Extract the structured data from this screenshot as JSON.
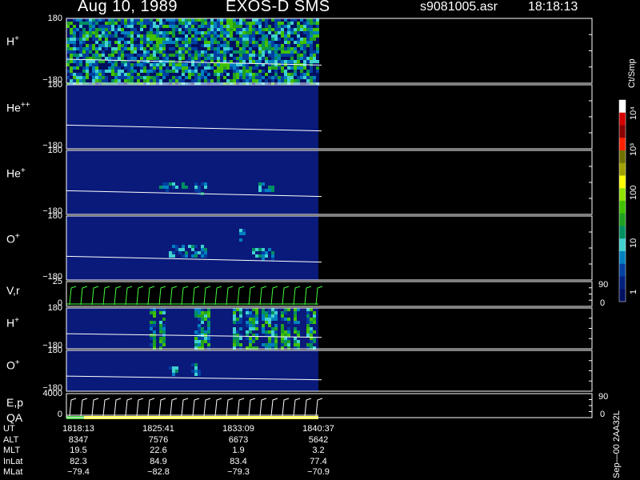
{
  "header": {
    "date": "Aug 10, 1989",
    "instrument": "EXOS-D SMS",
    "filename": "s9081005.asr",
    "time": "18:18:13"
  },
  "panels": [
    {
      "label": "H",
      "sup": "+",
      "ytop": "180",
      "ybot": "−180",
      "type": "spectrogram"
    },
    {
      "label": "He",
      "sup": "++",
      "ytop": "180",
      "ybot": "−180",
      "type": "spectrogram"
    },
    {
      "label": "He",
      "sup": "+",
      "ytop": "180",
      "ybot": "−180",
      "type": "spectrogram"
    },
    {
      "label": "O",
      "sup": "+",
      "ytop": "180",
      "ybot": "−180",
      "type": "spectrogram"
    },
    {
      "label": "V,r",
      "sup": "",
      "ytop": "25",
      "ybot": "0",
      "rtop": "90",
      "rbot": "0",
      "type": "line"
    },
    {
      "label": "H",
      "sup": "+",
      "ytop": "180",
      "ybot": "−180",
      "type": "spectrogram"
    },
    {
      "label": "O",
      "sup": "+",
      "ytop": "180",
      "ybot": "−180",
      "type": "spectrogram"
    },
    {
      "label": "E,p",
      "label2": "QA",
      "sup": "",
      "ytop": "4000",
      "ybot": "0",
      "rtop": "90",
      "rbot": "0",
      "type": "line"
    }
  ],
  "colorbar": {
    "units": "Ct/Smp",
    "labels": [
      "10⁴",
      "10³",
      "100",
      "10",
      "1"
    ],
    "colors": [
      "#ffffff",
      "#d40000",
      "#8a0000",
      "#ff2000",
      "#707000",
      "#a0a000",
      "#ffff00",
      "#90e000",
      "#40c000",
      "#20a020",
      "#009060",
      "#40d0d0",
      "#0080c0",
      "#0040a0",
      "#002080",
      "#001060"
    ]
  },
  "chart_data": {
    "type": "heatmap",
    "title": "Aug 10, 1989   EXOS-D SMS",
    "x_tick_labels": [
      "1818:13",
      "1825:41",
      "1833:09",
      "1840:37"
    ],
    "series": [
      {
        "name": "H+",
        "pitch_range": [
          -180,
          180
        ]
      },
      {
        "name": "He++",
        "pitch_range": [
          -180,
          180
        ]
      },
      {
        "name": "He+",
        "pitch_range": [
          -180,
          180
        ]
      },
      {
        "name": "O+",
        "pitch_range": [
          -180,
          180
        ]
      },
      {
        "name": "V,r",
        "range": [
          0,
          25
        ]
      },
      {
        "name": "H+",
        "pitch_range": [
          -180,
          180
        ]
      },
      {
        "name": "O+",
        "pitch_range": [
          -180,
          180
        ]
      },
      {
        "name": "E,p",
        "range": [
          0,
          4000
        ]
      }
    ],
    "ephemeris": {
      "rows": [
        {
          "name": "UT",
          "values": [
            "1818:13",
            "1825:41",
            "1833:09",
            "1840:37"
          ]
        },
        {
          "name": "ALT",
          "values": [
            "8347",
            "7576",
            "6673",
            "5642"
          ]
        },
        {
          "name": "MLT",
          "values": [
            "19.5",
            "22.6",
            "1.9",
            "3.2"
          ]
        },
        {
          "name": "InLat",
          "values": [
            "82.3",
            "84.9",
            "83.4",
            "77.4"
          ]
        },
        {
          "name": "MLat",
          "values": [
            "−79.4",
            "−82.8",
            "−79.3",
            "−70.9"
          ]
        }
      ]
    },
    "colorbar_range_counts": [
      1,
      10000
    ]
  },
  "footer": {
    "version": "Sep—00  2AA32L"
  }
}
